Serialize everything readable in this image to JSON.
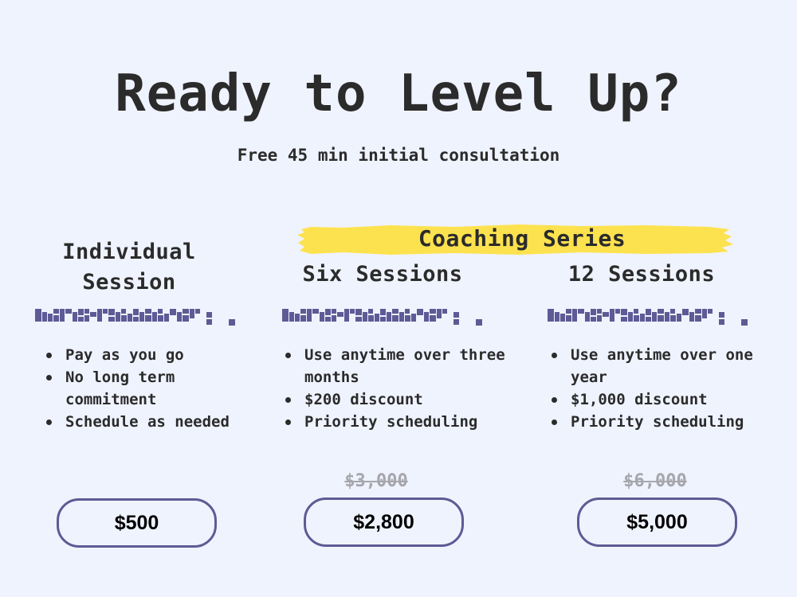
{
  "heading": {
    "title": "Ready to Level Up?",
    "subtitle": "Free 45 min initial consultation"
  },
  "series_label": "Coaching Series",
  "colors": {
    "background": "#eff3fe",
    "text": "#2b2b2b",
    "accent": "#5e5a95",
    "highlight": "#fde24f",
    "strike_price": "#a6a6ad"
  },
  "plans": [
    {
      "name_line1": "Individual",
      "name_line2": "Session",
      "features": [
        "Pay as you go",
        "No long term commitment",
        "Schedule as needed"
      ],
      "old_price": "",
      "price": "$500"
    },
    {
      "name_line1": "Six Sessions",
      "name_line2": "",
      "features": [
        "Use anytime over three months",
        "$200 discount",
        "Priority scheduling"
      ],
      "old_price": "$3,000",
      "price": "$2,800"
    },
    {
      "name_line1": "12 Sessions",
      "name_line2": "",
      "features": [
        "Use anytime over one year",
        "$1,000 discount",
        "Priority scheduling"
      ],
      "old_price": "$6,000",
      "price": "$5,000"
    }
  ]
}
